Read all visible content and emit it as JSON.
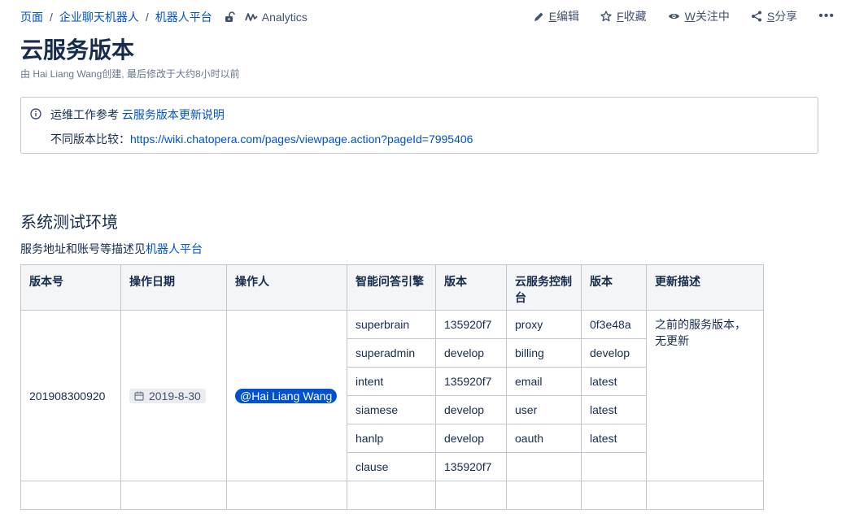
{
  "breadcrumb": [
    "页面",
    "企业聊天机器人",
    "机器人平台"
  ],
  "breadcrumb_sep": "/",
  "analytics_label": "Analytics",
  "actions": {
    "edit_key": "E",
    "edit_label": "编辑",
    "fav_key": "F",
    "fav_label": "收藏",
    "watch_key": "W",
    "watch_label": "关注中",
    "share_key": "S",
    "share_label": "分享",
    "more": "•••"
  },
  "page_title": "云服务版本",
  "meta": "由 Hai Liang Wang创建, 最后修改于大约8小时以前",
  "info": {
    "line1_text": "运维工作参考 ",
    "line1_link": "云服务版本更新说明",
    "line2_text": "不同版本比较：",
    "line2_link": "https://wiki.chatopera.com/pages/viewpage.action?pageId=7995406"
  },
  "section": {
    "heading": "系统测试环境",
    "desc_text": "服务地址和账号等描述见",
    "desc_link": "机器人平台"
  },
  "table": {
    "headers": [
      "版本号",
      "操作日期",
      "操作人",
      "智能问答引擎",
      "版本",
      "云服务控制台",
      "版本",
      "更新描述"
    ],
    "version_no": "201908300920",
    "date": "2019-8-30",
    "operator": "@Hai Liang Wang",
    "engine_rows": [
      {
        "engine": "superbrain",
        "ver": "135920f7",
        "console": "proxy",
        "cver": "0f3e48a"
      },
      {
        "engine": "superadmin",
        "ver": "develop",
        "console": "billing",
        "cver": "develop"
      },
      {
        "engine": "intent",
        "ver": "135920f7",
        "console": "email",
        "cver": "latest"
      },
      {
        "engine": "siamese",
        "ver": "develop",
        "console": "user",
        "cver": "latest"
      },
      {
        "engine": "hanlp",
        "ver": "develop",
        "console": "oauth",
        "cver": "latest"
      },
      {
        "engine": "clause",
        "ver": "135920f7",
        "console": "",
        "cver": ""
      }
    ],
    "update_desc": "之前的服务版本，无更新"
  }
}
